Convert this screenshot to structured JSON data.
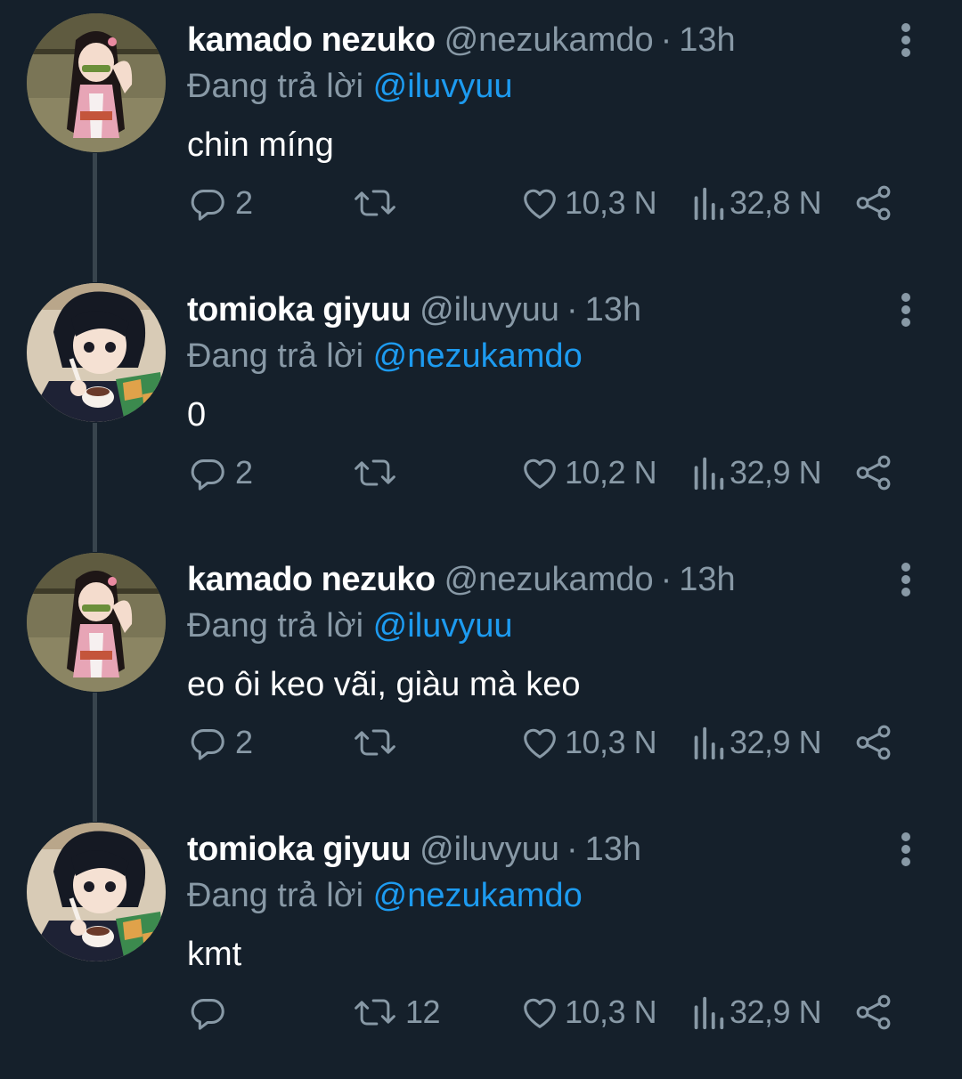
{
  "tweets": [
    {
      "name": "kamado nezuko",
      "handle": "@nezukamdo",
      "separator": "·",
      "time": "13h",
      "reply_prefix": "Đang trả lời",
      "reply_to": "@iluvyuu",
      "text": "chin míng",
      "reply_count": "2",
      "retweet_count": "",
      "like_count": "10,3 N",
      "view_count": "32,8 N",
      "avatar": "nezuko-avatar"
    },
    {
      "name": "tomioka giyuu",
      "handle": "@iluvyuu",
      "separator": "·",
      "time": "13h",
      "reply_prefix": "Đang trả lời",
      "reply_to": "@nezukamdo",
      "text": "0",
      "reply_count": "2",
      "retweet_count": "",
      "like_count": "10,2 N",
      "view_count": "32,9 N",
      "avatar": "giyuu-avatar"
    },
    {
      "name": "kamado nezuko",
      "handle": "@nezukamdo",
      "separator": "·",
      "time": "13h",
      "reply_prefix": "Đang trả lời",
      "reply_to": "@iluvyuu",
      "text": "eo ôi keo vãi, giàu mà keo",
      "reply_count": "2",
      "retweet_count": "",
      "like_count": "10,3 N",
      "view_count": "32,9 N",
      "avatar": "nezuko-avatar"
    },
    {
      "name": "tomioka giyuu",
      "handle": "@iluvyuu",
      "separator": "·",
      "time": "13h",
      "reply_prefix": "Đang trả lời",
      "reply_to": "@nezukamdo",
      "text": "kmt",
      "reply_count": "",
      "retweet_count": "12",
      "like_count": "10,3 N",
      "view_count": "32,9 N",
      "avatar": "giyuu-avatar"
    }
  ],
  "icons": {
    "reply": "reply-icon",
    "retweet": "retweet-icon",
    "like": "heart-icon",
    "views": "views-icon",
    "share": "share-icon",
    "more": "more-vertical-icon"
  },
  "colors": {
    "background": "#15202b",
    "muted": "#8899a6",
    "link": "#1d9bf0",
    "thread_line": "#38444d"
  }
}
